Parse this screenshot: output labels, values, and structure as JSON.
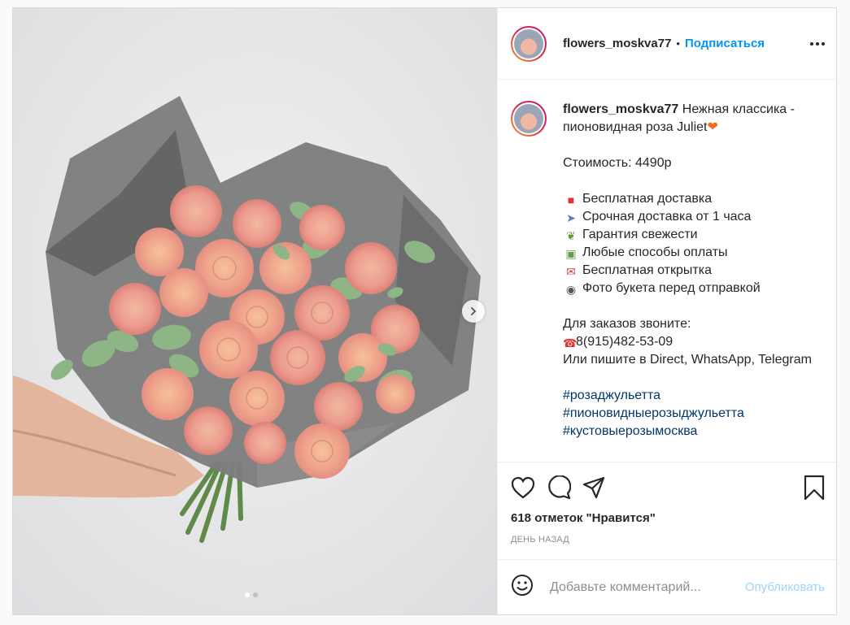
{
  "post": {
    "username": "flowers_moskva77",
    "separator": "•",
    "follow_label": "Подписаться"
  },
  "caption": {
    "username": "flowers_moskva77",
    "title": "Нежная классика - пионовидная роза Juliet",
    "price": "Стоимость: 4490р",
    "features": [
      {
        "icon": "car-icon",
        "text": "Бесплатная доставка"
      },
      {
        "icon": "rocket-icon",
        "text": "Срочная доставка от 1 часа"
      },
      {
        "icon": "leaf-icon",
        "text": "Гарантия свежести"
      },
      {
        "icon": "money-icon",
        "text": "Любые способы оплаты"
      },
      {
        "icon": "envelope-heart-icon",
        "text": "Бесплатная открытка"
      },
      {
        "icon": "camera-icon",
        "text": "Фото букета перед отправкой"
      }
    ],
    "order_title": "Для заказов звоните:",
    "phone": "8(915)482-53-09",
    "order_alt": "Или пишите в Direct, WhatsApp, Telegram",
    "hashtags": [
      "#розаджульетта",
      "#пионовидныерозыджульетта",
      "#кустовыерозымосква"
    ]
  },
  "actions": {
    "likes": "618 отметок \"Нравится\"",
    "time": "ДЕНЬ НАЗАД"
  },
  "comment": {
    "placeholder": "Добавьте комментарий...",
    "publish_label": "Опубликовать"
  },
  "colors": {
    "accent": "#0095f6",
    "hashtag": "#00376b",
    "heart_emoji": "#f26a1b"
  },
  "carousel": {
    "slides": 2,
    "current": 1
  }
}
